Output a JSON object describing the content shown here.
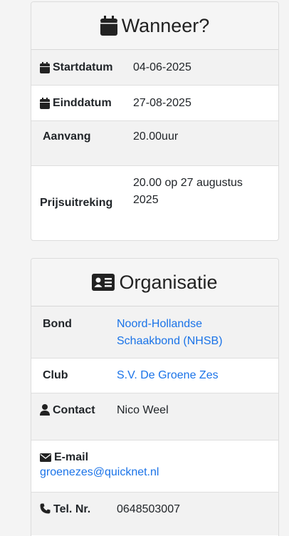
{
  "when": {
    "title": "Wanneer?",
    "rows": [
      {
        "label": "Startdatum",
        "value": "04-06-2025"
      },
      {
        "label": "Einddatum",
        "value": "27-08-2025"
      },
      {
        "label": "Aanvang",
        "value": "20.00uur"
      },
      {
        "label": "Prijsuitreking",
        "value": "20.00 op 27 augustus 2025"
      }
    ]
  },
  "org": {
    "title": "Organisatie",
    "bond": {
      "label": "Bond",
      "value": "Noord-Hollandse Schaakbond (NHSB)"
    },
    "club": {
      "label": "Club",
      "value": "S.V. De Groene Zes"
    },
    "contact": {
      "label": "Contact",
      "value": "Nico Weel"
    },
    "email": {
      "label": "E-mail",
      "value": "groenezes@quicknet.nl"
    },
    "phone": {
      "label": "Tel. Nr.",
      "value": "0648503007"
    }
  },
  "colors": {
    "link": "#1a73e8"
  },
  "icons": [
    "calendar-icon",
    "id-card-icon",
    "user-icon",
    "envelope-icon",
    "phone-icon"
  ]
}
